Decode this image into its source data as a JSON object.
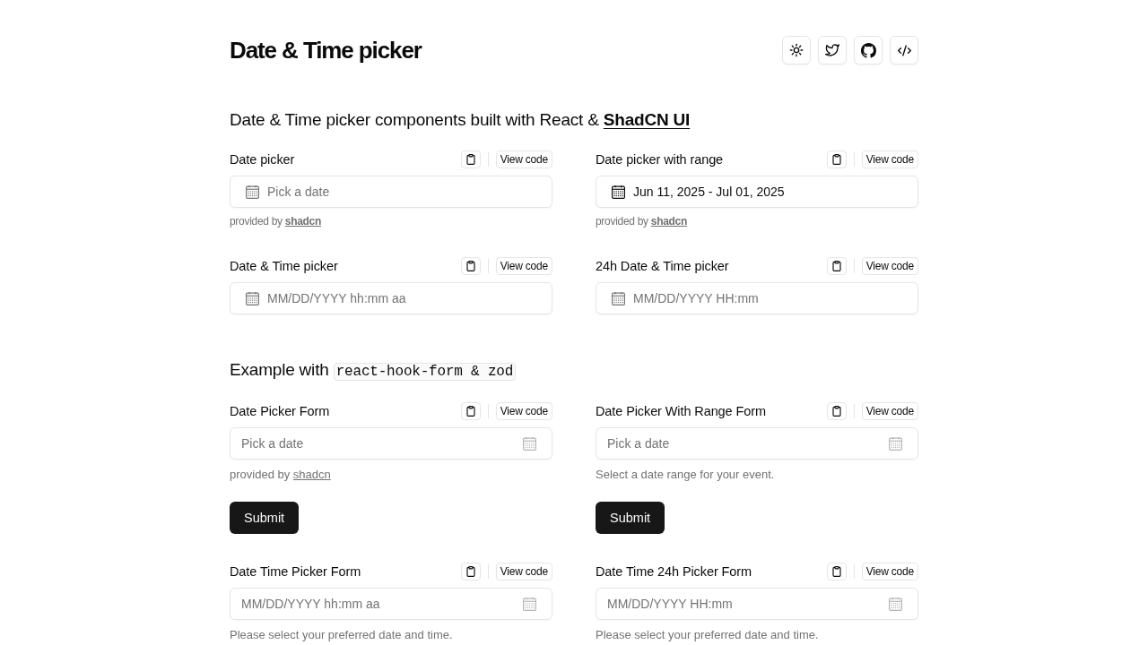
{
  "header": {
    "title": "Date & Time picker"
  },
  "sections": [
    {
      "intro": {
        "text": "Date & Time picker components built with React & ",
        "link": "ShadCN UI"
      },
      "demos": [
        {
          "kind": "plain",
          "title": "Date picker",
          "view_code": "View code",
          "field": {
            "placeholder": "Pick a date"
          },
          "note": {
            "text": "provided by ",
            "link": "shadcn"
          }
        },
        {
          "kind": "plain",
          "title": "Date picker with range",
          "view_code": "View code",
          "field": {
            "value": "Jun 11, 2025 - Jul 01, 2025"
          },
          "note": {
            "text": "provided by ",
            "link": "shadcn"
          }
        },
        {
          "kind": "plain",
          "title": "Date & Time picker",
          "view_code": "View code",
          "field": {
            "placeholder": "MM/DD/YYYY hh:mm aa"
          }
        },
        {
          "kind": "plain",
          "title": "24h Date & Time picker",
          "view_code": "View code",
          "field": {
            "placeholder": "MM/DD/YYYY HH:mm"
          }
        }
      ]
    },
    {
      "intro": {
        "text": "Example with ",
        "code": "react-hook-form & zod"
      },
      "demos": [
        {
          "kind": "form",
          "title": "Date Picker Form",
          "view_code": "View code",
          "field": {
            "placeholder": "Pick a date"
          },
          "note": {
            "text": "provided by ",
            "link": "shadcn"
          },
          "submit": "Submit"
        },
        {
          "kind": "form",
          "title": "Date Picker With Range Form",
          "view_code": "View code",
          "field": {
            "placeholder": "Pick a date"
          },
          "note": {
            "text": "Select a date range for your event."
          },
          "submit": "Submit"
        },
        {
          "kind": "form",
          "title": "Date Time Picker Form",
          "view_code": "View code",
          "field": {
            "placeholder": "MM/DD/YYYY hh:mm aa"
          },
          "note": {
            "text": "Please select your preferred date and time."
          }
        },
        {
          "kind": "form",
          "title": "Date Time 24h Picker Form",
          "view_code": "View code",
          "field": {
            "placeholder": "MM/DD/YYYY HH:mm"
          },
          "note": {
            "text": "Please select your preferred date and time."
          }
        }
      ]
    }
  ]
}
